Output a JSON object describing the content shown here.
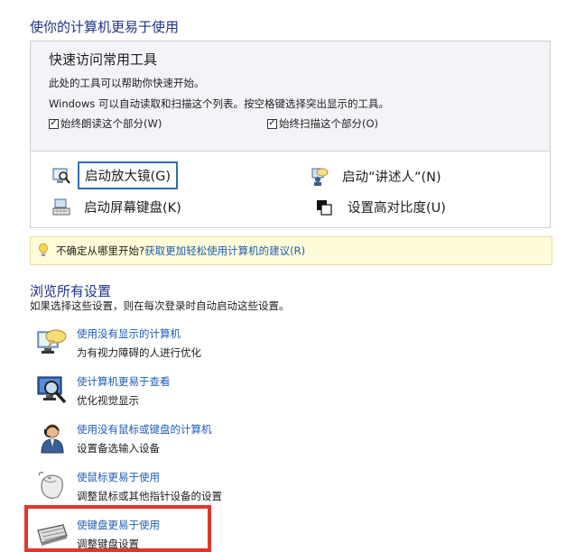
{
  "header": {
    "title": "使你的计算机更易于使用"
  },
  "quick_access": {
    "heading": "快速访问常用工具",
    "line1": "此处的工具可以帮助你快速开始。",
    "line2": "Windows 可以自动读取和扫描这个列表。按空格键选择突出显示的工具。",
    "checkbox_read": {
      "label": "始终朗读这个部分(W)",
      "checked": true
    },
    "checkbox_scan": {
      "label": "始终扫描这个部分(O)",
      "checked": true
    },
    "tools": {
      "magnifier": "启动放大镜(G)",
      "narrator": "启动”讲述人”(N)",
      "osk": "启动屏幕键盘(K)",
      "contrast": "设置高对比度(U)"
    }
  },
  "hint": {
    "prefix": "不确定从哪里开始?",
    "link": "获取更加轻松使用计算机的建议(R)"
  },
  "browse": {
    "title": "浏览所有设置",
    "description": "如果选择这些设置，则在每次登录时自动启动这些设置。",
    "items": [
      {
        "link": "使用没有显示的计算机",
        "desc": "为有视力障碍的人进行优化",
        "icon": "monitor-speech-icon"
      },
      {
        "link": "使计算机更易于查看",
        "desc": "优化视觉显示",
        "icon": "monitor-magnifier-icon"
      },
      {
        "link": "使用没有鼠标或键盘的计算机",
        "desc": "设置备选输入设备",
        "icon": "person-headset-icon"
      },
      {
        "link": "使鼠标更易于使用",
        "desc": "调整鼠标或其他指针设备的设置",
        "icon": "mouse-icon"
      },
      {
        "link": "使键盘更易于使用",
        "desc": "调整键盘设置",
        "icon": "keyboard-icon"
      }
    ]
  },
  "colors": {
    "heading_blue": "#1e3287",
    "link_blue": "#1e5cb3",
    "hint_bg": "#fefbd8",
    "highlight_red": "#e0362b",
    "focus_blue": "#2c6fb8"
  }
}
